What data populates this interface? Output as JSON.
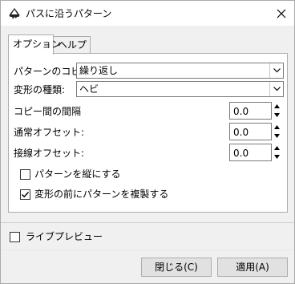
{
  "window": {
    "title": "パスに沿うパターン",
    "icon": "inkscape-app-icon",
    "close_icon": "close-icon"
  },
  "tabs": [
    {
      "label": "オプション",
      "active": true
    },
    {
      "label": "ヘルプ",
      "active": false
    }
  ],
  "options": {
    "copy_label": "パターンのコピー:",
    "copy_value": "繰り返し",
    "deform_label": "変形の種類:",
    "deform_value": "ヘビ",
    "spacing_label": "コピー間の間隔",
    "spacing_value": "0.0",
    "normal_offset_label": "通常オフセット:",
    "normal_offset_value": "0.0",
    "tangent_offset_label": "接線オフセット:",
    "tangent_offset_value": "0.0",
    "vertical_label": "パターンを縦にする",
    "vertical_checked": false,
    "duplicate_label": "変形の前にパターンを複製する",
    "duplicate_checked": true
  },
  "live_preview": {
    "label": "ライブプレビュー",
    "checked": false
  },
  "buttons": {
    "close_label": "閉じる(C)",
    "apply_label": "適用(A)"
  }
}
